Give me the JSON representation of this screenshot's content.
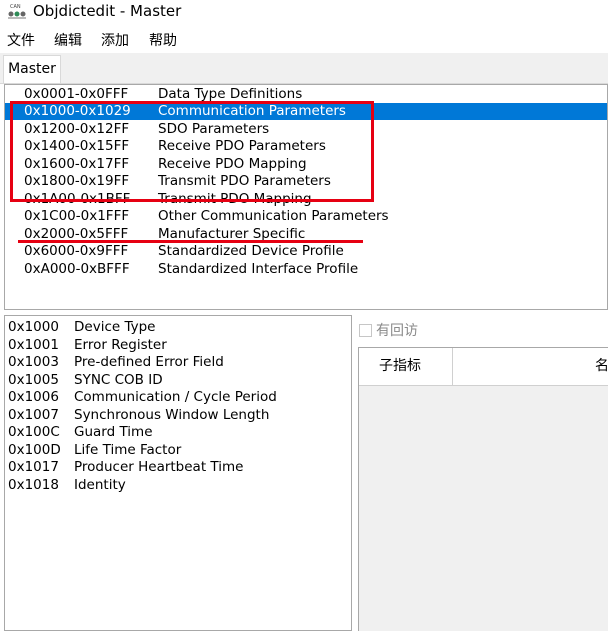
{
  "window": {
    "title": "Objdictedit - Master"
  },
  "menu": [
    {
      "label": "文件"
    },
    {
      "label": "编辑"
    },
    {
      "label": "添加"
    },
    {
      "label": "帮助"
    }
  ],
  "tabs": [
    {
      "label": "Master"
    }
  ],
  "ranges": [
    {
      "code": "0x0001-0x0FFF",
      "name": "Data Type Definitions"
    },
    {
      "code": "0x1000-0x1029",
      "name": "Communication Parameters",
      "selected": true
    },
    {
      "code": "0x1200-0x12FF",
      "name": "SDO Parameters"
    },
    {
      "code": "0x1400-0x15FF",
      "name": "Receive PDO Parameters"
    },
    {
      "code": "0x1600-0x17FF",
      "name": "Receive PDO Mapping"
    },
    {
      "code": "0x1800-0x19FF",
      "name": "Transmit PDO Parameters"
    },
    {
      "code": "0x1A00-0x1BFF",
      "name": "Transmit PDO Mapping"
    },
    {
      "code": "0x1C00-0x1FFF",
      "name": "Other Communication Parameters"
    },
    {
      "code": "0x2000-0x5FFF",
      "name": "Manufacturer Specific"
    },
    {
      "code": "0x6000-0x9FFF",
      "name": "Standardized Device Profile"
    },
    {
      "code": "0xA000-0xBFFF",
      "name": "Standardized Interface Profile"
    }
  ],
  "indexes": [
    {
      "code": "0x1000",
      "name": "Device Type"
    },
    {
      "code": "0x1001",
      "name": "Error Register"
    },
    {
      "code": "0x1003",
      "name": "Pre-defined Error Field"
    },
    {
      "code": "0x1005",
      "name": "SYNC COB ID"
    },
    {
      "code": "0x1006",
      "name": "Communication / Cycle Period"
    },
    {
      "code": "0x1007",
      "name": "Synchronous Window Length"
    },
    {
      "code": "0x100C",
      "name": "Guard Time"
    },
    {
      "code": "0x100D",
      "name": "Life Time Factor"
    },
    {
      "code": "0x1017",
      "name": "Producer Heartbeat Time"
    },
    {
      "code": "0x1018",
      "name": "Identity"
    }
  ],
  "subindex_panel": {
    "checkbox_label": "有回访",
    "checked": false,
    "columns": [
      "子指标",
      "名"
    ]
  },
  "colors": {
    "selection": "#0078d7",
    "annotation": "#e60012"
  }
}
